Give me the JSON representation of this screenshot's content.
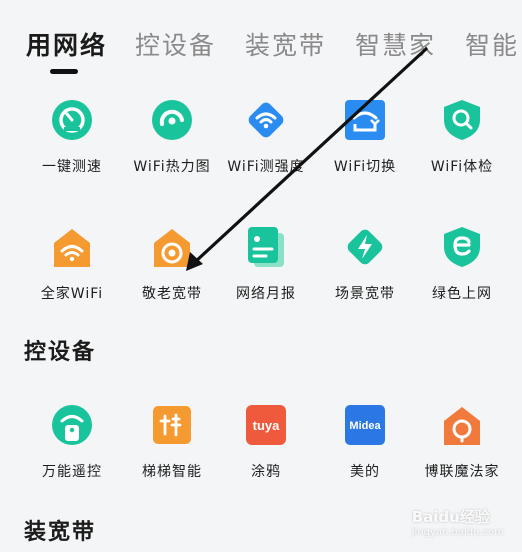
{
  "tabs": [
    {
      "label": "用网络",
      "active": true
    },
    {
      "label": "控设备",
      "active": false
    },
    {
      "label": "装宽带",
      "active": false
    },
    {
      "label": "智慧家",
      "active": false
    },
    {
      "label": "智能",
      "active": false
    }
  ],
  "network": {
    "row1": [
      {
        "label": "一键测速",
        "icon": "speedometer-icon"
      },
      {
        "label": "WiFi热力图",
        "icon": "wifi-heatmap-icon"
      },
      {
        "label": "WiFi测强度",
        "icon": "wifi-strength-icon"
      },
      {
        "label": "WiFi切换",
        "icon": "wifi-switch-icon"
      },
      {
        "label": "WiFi体检",
        "icon": "wifi-checkup-icon"
      }
    ],
    "row2": [
      {
        "label": "全家WiFi",
        "icon": "home-wifi-icon"
      },
      {
        "label": "敬老宽带",
        "icon": "elderly-broadband-icon"
      },
      {
        "label": "网络月报",
        "icon": "monthly-report-icon"
      },
      {
        "label": "场景宽带",
        "icon": "scene-broadband-icon"
      },
      {
        "label": "绿色上网",
        "icon": "green-internet-icon"
      }
    ]
  },
  "devices": {
    "title": "控设备",
    "items": [
      {
        "label": "万能遥控",
        "icon": "remote-control-icon"
      },
      {
        "label": "梯梯智能",
        "icon": "titi-smart-icon"
      },
      {
        "label": "涂鸦",
        "icon": "tuya-icon",
        "logo_text": "tuya"
      },
      {
        "label": "美的",
        "icon": "midea-icon",
        "logo_text": "Midea"
      },
      {
        "label": "博联魔法家",
        "icon": "broadlink-icon"
      }
    ]
  },
  "broadband": {
    "title": "装宽带"
  },
  "watermark": {
    "text": "Baidu经验",
    "sub": "jingyan.baidu.com"
  },
  "colors": {
    "teal": "#19c39b",
    "blue": "#2a8cf0",
    "orange": "#f59a30",
    "tuya_red": "#f05a3c",
    "midea_blue": "#2b78e4"
  }
}
